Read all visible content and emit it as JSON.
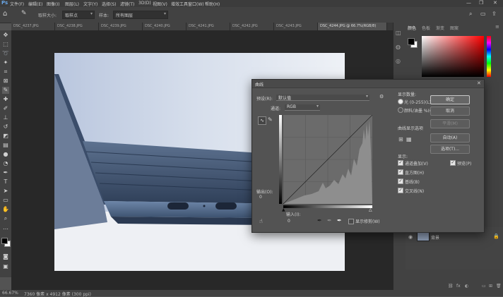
{
  "menubar": {
    "items": [
      "文件(F)",
      "编辑(E)",
      "图像(I)",
      "图层(L)",
      "文字(Y)",
      "选择(S)",
      "滤镜(T)",
      "3D(D)",
      "视图(V)",
      "增效工具",
      "窗口(W)",
      "帮助(H)"
    ]
  },
  "window": {
    "minimize_glyph": "—",
    "maximize_glyph": "❐",
    "close_glyph": "✕"
  },
  "options_bar": {
    "sample_size_label": "取样大小:",
    "sample_size_value": "取样点",
    "sample_label": "样本:",
    "sample_value": "所有图层"
  },
  "tabs": [
    "DSC_4237.JPG",
    "DSC_4238.JPG",
    "DSC_4239.JPG",
    "DSC_4240.JPG",
    "DSC_4241.JPG",
    "DSC_4242.JPG",
    "DSC_4243.JPG",
    "DSC_4244.JPG @ 66.7%(RGB/8)"
  ],
  "status": {
    "zoom": "66.67%",
    "doc_info": "7360 像素 x 4912 像素 (300 ppi)"
  },
  "color_panel": {
    "tabs": [
      "颜色",
      "色板",
      "渐变",
      "图案"
    ]
  },
  "curves": {
    "title": "曲线",
    "preset_label": "预设(R):",
    "preset_value": "默认值",
    "channel_label": "通道:",
    "channel_value": "RGB",
    "output_label": "输出(O):",
    "output_value": "0",
    "input_label": "输入(I):",
    "input_value": "0",
    "show_clipping_label": "显示修剪(W)",
    "curve_display_header": "曲线显示选项",
    "show_amount_header": "显示数量:",
    "light_option": "光 (0-255)(L)",
    "pigment_option": "颜料/油墨 %(G)",
    "show_header": "显示:",
    "channel_overlay": "通道叠加(V)",
    "histogram": "直方图(H)",
    "baseline": "基线(B)",
    "intersection": "交叉线(N)",
    "ok_button": "确定",
    "cancel_button": "取消",
    "smooth_button": "平滑(M)",
    "auto_button": "自动(A)",
    "options_button": "选项(T)...",
    "preview_label": "预览(P)"
  },
  "layers_panel": {
    "layer_name": "背景"
  },
  "colors": {
    "foreground": "#000000",
    "background": "#ffffff"
  }
}
